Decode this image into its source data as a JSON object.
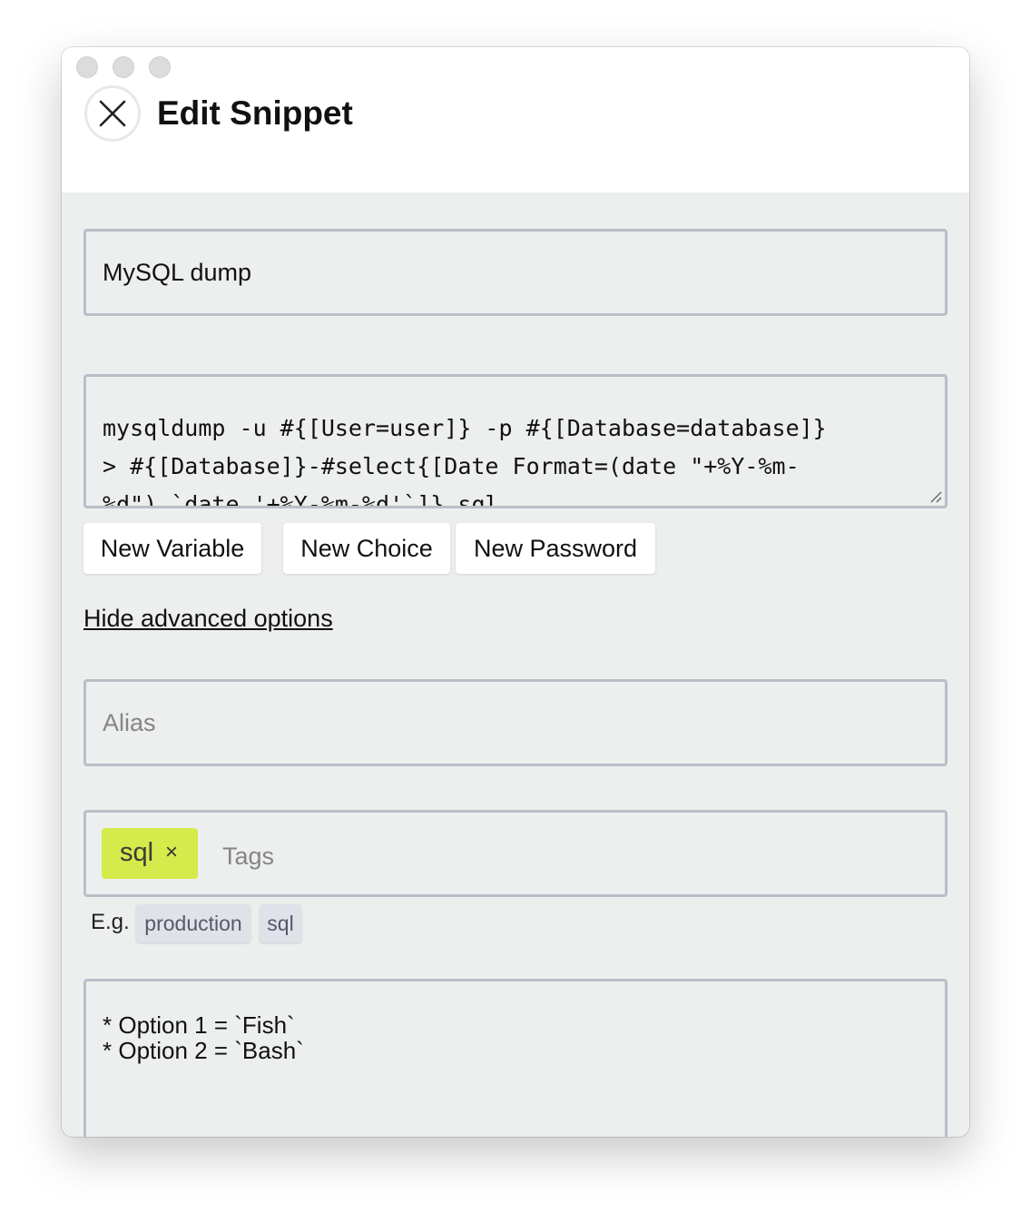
{
  "window": {
    "title": "Edit Snippet"
  },
  "form": {
    "name_value": "MySQL dump",
    "command_lines": [
      "mysqldump -u #{[User=user]} -p #{[Database=database]}",
      "> #{[Database]}-#select{[Date Format=(date \"+%Y-%m-",
      "%d\") `date '+%Y-%m-%d'`]}.sql"
    ],
    "buttons": {
      "new_variable": "New Variable",
      "new_choice": "New Choice",
      "new_password": "New Password"
    },
    "advanced_link": "Hide advanced options",
    "alias_placeholder": "Alias",
    "tags": {
      "chips": [
        {
          "label": "sql",
          "remove": "×",
          "color": "#d5ea4b"
        }
      ],
      "placeholder": "Tags",
      "example_label": "E.g.",
      "suggestions": [
        "production",
        "sql"
      ]
    },
    "description_lines": [
      "* Option 1 = `Fish`",
      "* Option 2 = `Bash`"
    ]
  }
}
